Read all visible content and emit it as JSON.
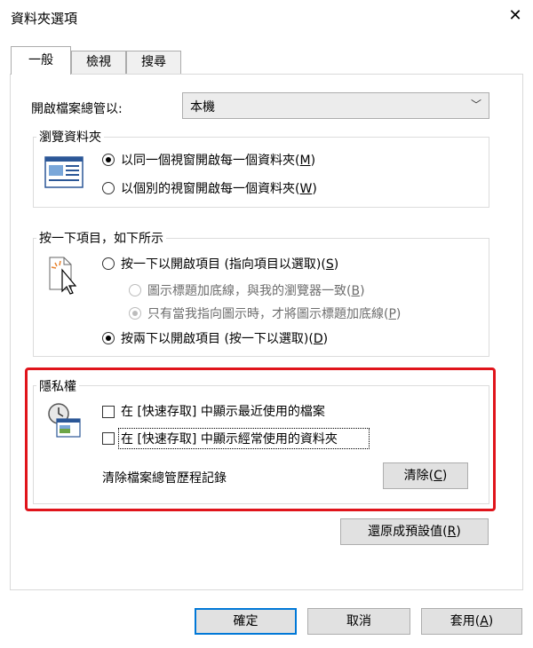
{
  "window": {
    "title": "資料夾選項"
  },
  "tabs": [
    {
      "label": "一般",
      "active": true
    },
    {
      "label": "檢視",
      "active": false
    },
    {
      "label": "搜尋",
      "active": false
    }
  ],
  "open_files": {
    "label": "開啟檔案總管以:",
    "selected": "本機"
  },
  "browse": {
    "title": "瀏覽資料夾",
    "opt1": "以同一個視窗開啟每一個資料夾(",
    "opt1_key": "M",
    "opt2": "以個別的視窗開啟每一個資料夾(",
    "opt2_key": "W",
    "selected": 0
  },
  "click": {
    "title": "按一下項目，如下所示",
    "single": "按一下以開啟項目 (指向項目以選取)(",
    "single_key": "S",
    "underline_browser": "圖示標題加底線，與我的瀏覽器一致(",
    "underline_browser_key": "B",
    "underline_point": "只有當我指向圖示時，才將圖示標題加底線(",
    "underline_point_key": "P",
    "double": "按兩下以開啟項目 (按一下以選取)(",
    "double_key": "D"
  },
  "privacy": {
    "title": "隱私權",
    "recent_files": "在 [快速存取] 中顯示最近使用的檔案",
    "frequent_folders": "在 [快速存取] 中顯示經常使用的資料夾",
    "clear_label": "清除檔案總管歷程記錄",
    "clear_button": "清除(",
    "clear_key": "C"
  },
  "restore_button": "還原成預設值(",
  "restore_key": "R",
  "footer": {
    "ok": "確定",
    "cancel": "取消",
    "apply": "套用(",
    "apply_key": "A"
  },
  "colors": {
    "highlight": "#e0141b",
    "focus": "#0078d7"
  }
}
